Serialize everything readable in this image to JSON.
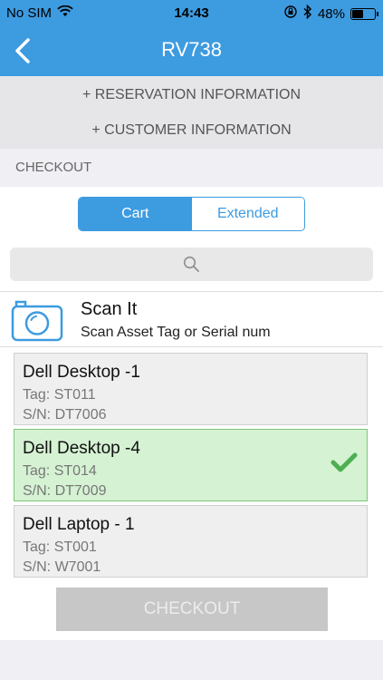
{
  "status_bar": {
    "carrier": "No SIM",
    "time": "14:43",
    "battery": "48%",
    "battery_level": 0.48
  },
  "nav": {
    "title": "RV738",
    "back_icon": "chevron-left-icon"
  },
  "sections": {
    "reservation": "+ RESERVATION INFORMATION",
    "customer": "+ CUSTOMER INFORMATION"
  },
  "checkout_header": "CHECKOUT",
  "tabs": [
    {
      "label": "Cart",
      "active": true
    },
    {
      "label": "Extended",
      "active": false
    }
  ],
  "search": {
    "icon": "search-icon"
  },
  "scan": {
    "title": "Scan It",
    "subtitle": "Scan Asset Tag or Serial num",
    "icon": "camera-icon"
  },
  "items": [
    {
      "name": "Dell Desktop -1",
      "tag": "Tag: ST011",
      "sn": "S/N: DT7006",
      "selected": false
    },
    {
      "name": "Dell Desktop -4",
      "tag": "Tag: ST014",
      "sn": "S/N: DT7009",
      "selected": true
    },
    {
      "name": "Dell Laptop - 1",
      "tag": "Tag: ST001",
      "sn": "S/N: W7001",
      "selected": false
    }
  ],
  "checkout_button": "CHECKOUT",
  "colors": {
    "accent": "#3d9be0",
    "selected_bg": "#d5f2d3",
    "check": "#4caf50",
    "disabled_button": "#c7c7c7"
  }
}
